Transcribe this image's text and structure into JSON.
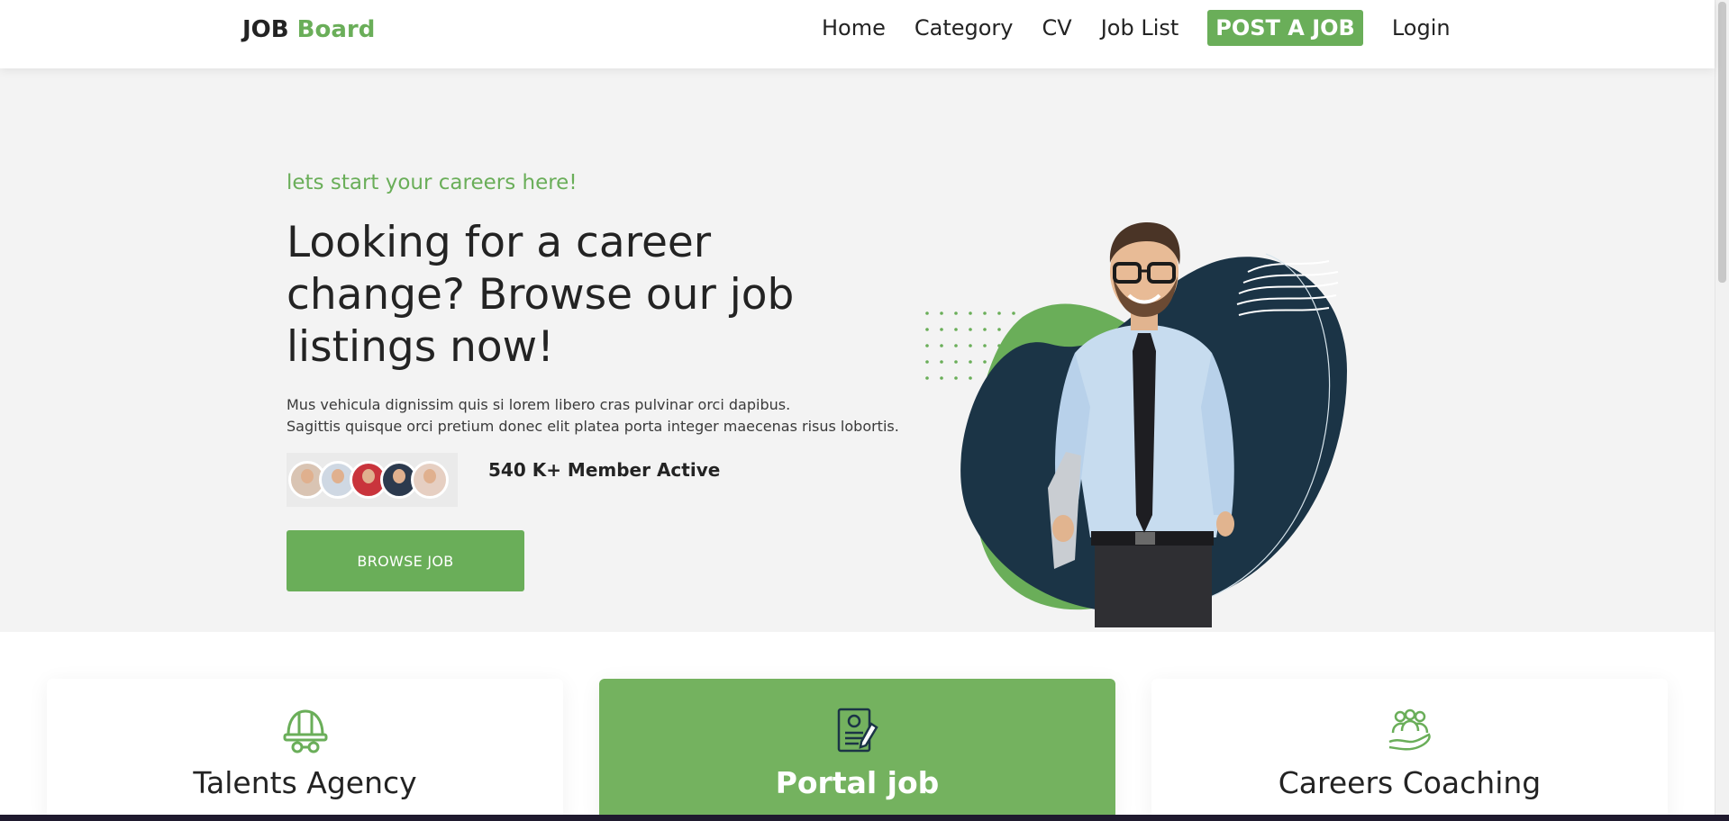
{
  "header": {
    "logo_main": "JOB",
    "logo_accent": "Board",
    "nav": [
      "Home",
      "Category",
      "CV",
      "Job List"
    ],
    "post_job": "POST A JOB",
    "login": "Login"
  },
  "hero": {
    "tagline": "lets start your careers here!",
    "headline": "Looking for a career change? Browse our job listings now!",
    "desc_line1": "Mus vehicula dignissim quis si lorem libero cras pulvinar orci dapibus.",
    "desc_line2": "Sagittis quisque orci pretium donec elit platea porta integer maecenas risus lobortis.",
    "members": "540 K+ Member Active",
    "browse_button": "BROWSE JOB"
  },
  "services": [
    {
      "title": "Talents Agency",
      "icon": "hard-hat-icon"
    },
    {
      "title": "Portal job",
      "icon": "resume-document-icon"
    },
    {
      "title": "Careers Coaching",
      "icon": "people-hand-icon"
    }
  ],
  "colors": {
    "accent": "#6aae59",
    "navy": "#1b3446",
    "dark_text": "#232323",
    "hero_bg": "#f3f3f3"
  }
}
